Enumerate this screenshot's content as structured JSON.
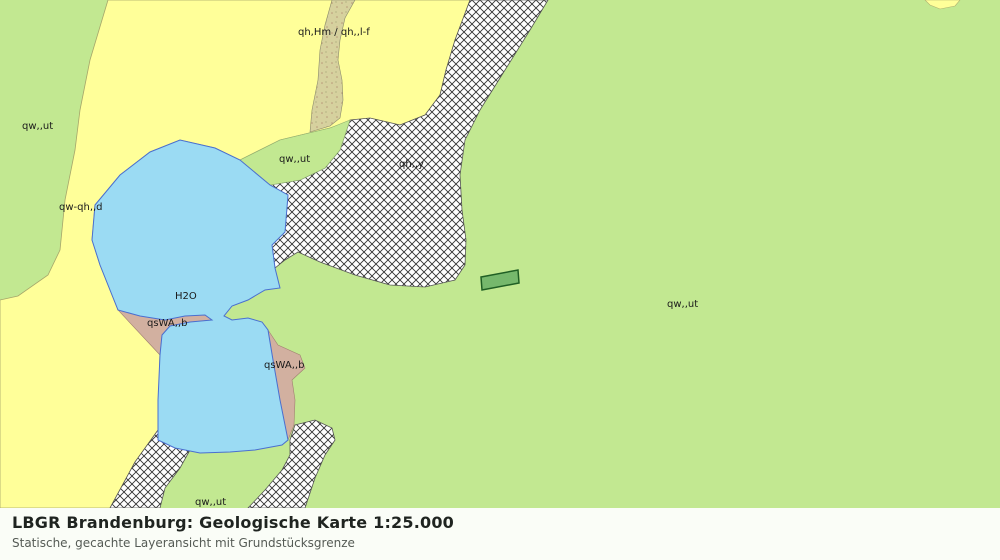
{
  "colors": {
    "qw_ut": "#c2e891",
    "qh_Hm": "#ffff99",
    "h2o": "#9bdbf3",
    "qsWA_b": "#d2b0a0",
    "qh_y_hatch": "#333333",
    "qh_Hm_stipple": "#d6d19e",
    "parcel_fill": "#76b86c",
    "parcel_stroke": "#1f5f24"
  },
  "map": {
    "labels": [
      {
        "id": "qwut-left",
        "text": "qw,,ut"
      },
      {
        "id": "qhhm",
        "text": "qh,Hm / qh,,l-f"
      },
      {
        "id": "qwut-mid",
        "text": "qw,,ut"
      },
      {
        "id": "qhy",
        "text": "qh,,y"
      },
      {
        "id": "qwqhd",
        "text": "qw-qh,,d"
      },
      {
        "id": "h2o",
        "text": "H2O"
      },
      {
        "id": "qswa-1",
        "text": "qsWA,,b"
      },
      {
        "id": "qswa-2",
        "text": "qsWA,,b"
      },
      {
        "id": "qwut-right",
        "text": "qw,,ut"
      },
      {
        "id": "qwut-bottom",
        "text": "qw,,ut"
      }
    ]
  },
  "footer": {
    "title": "LBGR Brandenburg: Geologische Karte 1:25.000",
    "subtitle": "Statische, gecachte Layeransicht mit Grundstücksgrenze"
  }
}
